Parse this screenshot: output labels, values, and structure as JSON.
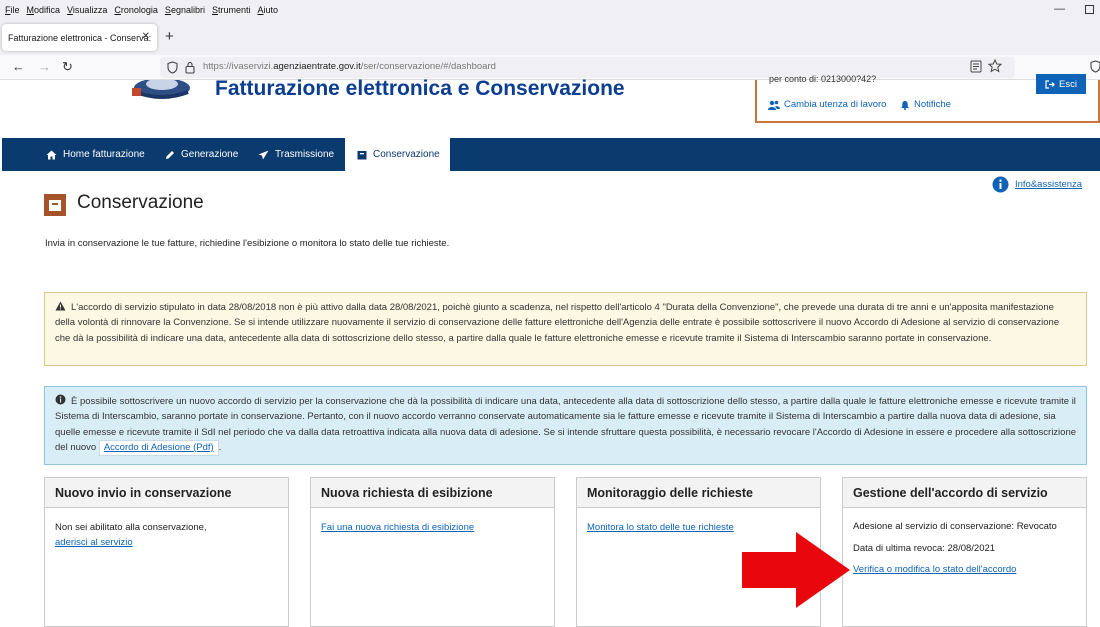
{
  "browser": {
    "menu": [
      "File",
      "Modifica",
      "Visualizza",
      "Cronologia",
      "Segnalibri",
      "Strumenti",
      "Aiuto"
    ],
    "tab_title": "Fatturazione elettronica - Conserva:",
    "url_prefix": "https://ivaservizi.",
    "url_domain": "agenziaentrate.gov.it",
    "url_suffix": "/ser/conservazione/#/dashboard"
  },
  "header": {
    "title": "Fatturazione elettronica e Conservazione",
    "user_top": "per conto di: 0213000?42?",
    "esci": "Esci",
    "cambia": "Cambia utenza di lavoro",
    "notifiche": "Notifiche"
  },
  "nav": [
    {
      "label": "Home fatturazione",
      "icon": "home-icon"
    },
    {
      "label": "Generazione",
      "icon": "pencil-icon"
    },
    {
      "label": "Trasmissione",
      "icon": "send-icon"
    },
    {
      "label": "Conservazione",
      "icon": "archive-icon"
    }
  ],
  "info_link": "Info&assistenza",
  "page": {
    "title": "Conservazione",
    "intro": "Invia in conservazione le tue fatture, richiedine l'esibizione o monitora lo stato delle tue richieste."
  },
  "warning": "L'accordo di servizio stipulato in data 28/08/2018 non è più attivo dalla data 28/08/2021, poichè giunto a scadenza, nel rispetto dell'articolo 4 \"Durata della Convenzione\", che prevede una durata di tre anni e un'apposita manifestazione della volontà di rinnovare la Convenzione. Se si intende utilizzare nuovamente il servizio di conservazione delle fatture elettroniche dell'Agenzia delle entrate è possibile sottoscrivere il nuovo Accordo di Adesione al servizio di conservazione che dà la possibilità di indicare una data, antecedente alla data di sottoscrizione dello stesso, a partire dalla quale le fatture elettroniche emesse e ricevute tramite il Sistema di Interscambio saranno portate in conservazione.",
  "info": {
    "text": "È possibile sottoscrivere un nuovo accordo di servizio per la conservazione che dà la possibilità di indicare una data, antecedente alla data di sottoscrizione dello stesso, a partire dalla quale le fatture elettroniche emesse e ricevute tramite il Sistema di Interscambio, saranno portate in conservazione. Pertanto, con il nuovo accordo verranno conservate automaticamente sia le fatture emesse e ricevute tramite il Sistema di Interscambio a partire dalla nuova data di adesione, sia quelle emesse e ricevute tramite il SdI nel periodo che va dalla data retroattiva indicata alla nuova data di adesione. Se si intende sfruttare questa possibilità, è necessario revocare l'Accordo di Adesione in essere e procedere alla sottoscrizione del nuovo",
    "link": "Accordo di Adesione (Pdf)",
    "after": "."
  },
  "cards": [
    {
      "title": "Nuovo invio in conservazione",
      "text": "Non sei abilitato alla conservazione,",
      "link": "aderisci al servizio"
    },
    {
      "title": "Nuova richiesta di esibizione",
      "link": "Fai una nuova richiesta di esibizione"
    },
    {
      "title": "Monitoraggio delle richieste",
      "link": "Monitora lo stato delle tue richieste"
    },
    {
      "title": "Gestione dell'accordo di servizio",
      "line1": "Adesione al servizio di conservazione: Revocato",
      "line2": "Data di ultima revoca: 28/08/2021",
      "link": "Verifica o modifica lo stato dell'accordo"
    }
  ],
  "colors": {
    "nav_bg": "#0b3a6e",
    "accent": "#0e63b6",
    "warning_bg": "#fcf8e3",
    "info_bg": "#d9edf7",
    "arrow": "#e8070c"
  }
}
